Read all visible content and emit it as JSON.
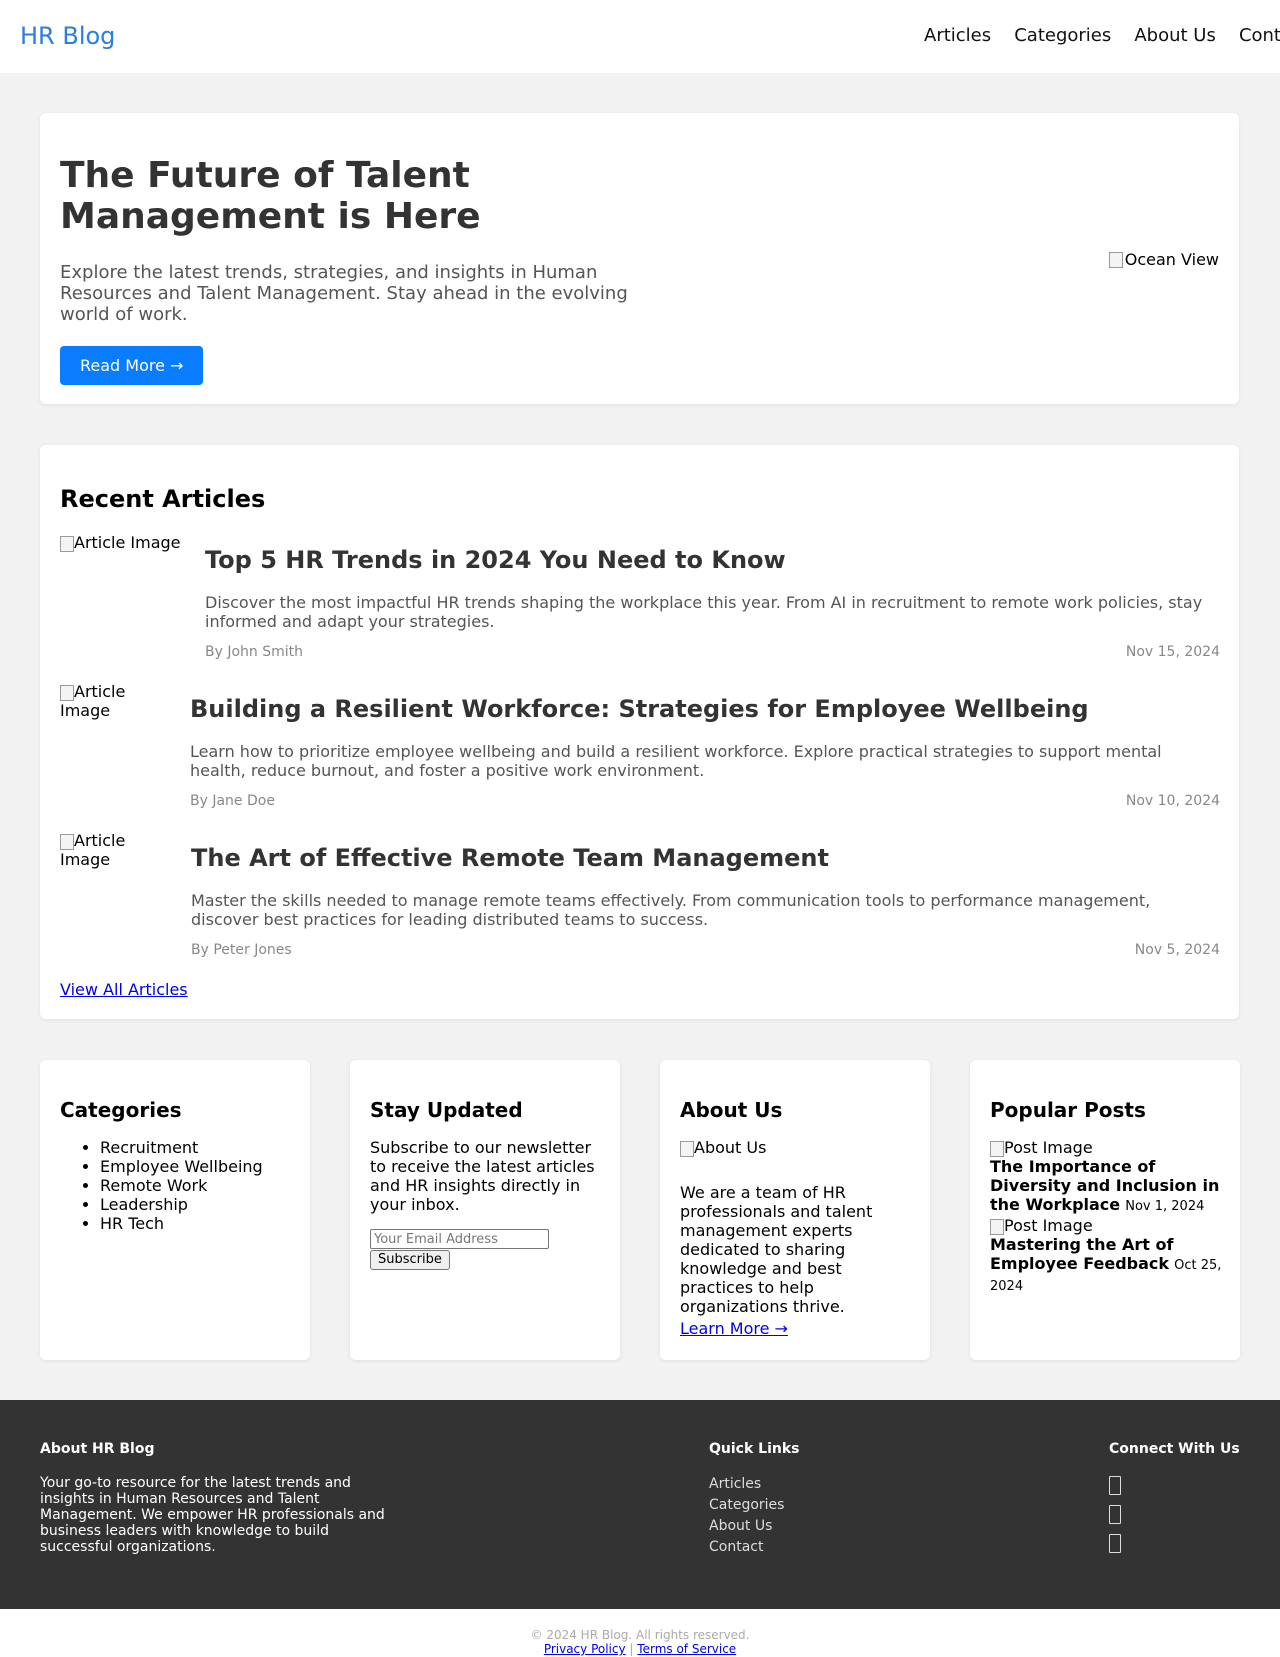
{
  "header": {
    "logo": "HR Blog",
    "nav": [
      "Articles",
      "Categories",
      "About Us",
      "Contact"
    ]
  },
  "hero": {
    "title": "The Future of Talent Management is Here",
    "description": "Explore the latest trends, strategies, and insights in Human Resources and Talent Management. Stay ahead in the evolving world of work.",
    "button": "Read More →",
    "image_alt": "Ocean View"
  },
  "recent": {
    "title": "Recent Articles",
    "articles": [
      {
        "image_alt": "Article Image",
        "title": "Top 5 HR Trends in 2024 You Need to Know",
        "excerpt": "Discover the most impactful HR trends shaping the workplace this year. From AI in recruitment to remote work policies, stay informed and adapt your strategies.",
        "author": "By John Smith",
        "date": "Nov 15, 2024"
      },
      {
        "image_alt": "Article Image",
        "title": "Building a Resilient Workforce: Strategies for Employee Wellbeing",
        "excerpt": "Learn how to prioritize employee wellbeing and build a resilient workforce. Explore practical strategies to support mental health, reduce burnout, and foster a positive work environment.",
        "author": "By Jane Doe",
        "date": "Nov 10, 2024"
      },
      {
        "image_alt": "Article Image",
        "title": "The Art of Effective Remote Team Management",
        "excerpt": "Master the skills needed to manage remote teams effectively. From communication tools to performance management, discover best practices for leading distributed teams to success.",
        "author": "By Peter Jones",
        "date": "Nov 5, 2024"
      }
    ],
    "view_all": "View All Articles"
  },
  "categories": {
    "title": "Categories",
    "items": [
      "Recruitment",
      "Employee Wellbeing",
      "Remote Work",
      "Leadership",
      "HR Tech"
    ]
  },
  "newsletter": {
    "title": "Stay Updated",
    "text": "Subscribe to our newsletter to receive the latest articles and HR insights directly in your inbox.",
    "placeholder": "Your Email Address",
    "button": "Subscribe"
  },
  "about": {
    "title": "About Us",
    "image_alt": "About Us",
    "text": "We are a team of HR professionals and talent management experts dedicated to sharing knowledge and best practices to help organizations thrive.",
    "link": "Learn More →"
  },
  "popular": {
    "title": "Popular Posts",
    "posts": [
      {
        "image_alt": "Post Image",
        "title": "The Importance of Diversity and Inclusion in the Workplace",
        "date": "Nov 1, 2024"
      },
      {
        "image_alt": "Post Image",
        "title": "Mastering the Art of Employee Feedback",
        "date": "Oct 25, 2024"
      }
    ]
  },
  "footer": {
    "about_heading": "About HR Blog",
    "about_text": "Your go-to resource for the latest trends and insights in Human Resources and Talent Management. We empower HR professionals and business leaders with knowledge to build successful organizations.",
    "links_heading": "Quick Links",
    "links": [
      "Articles",
      "Categories",
      "About Us",
      "Contact"
    ],
    "social_heading": "Connect With Us",
    "social_icons": [
      "social-icon",
      "social-icon",
      "social-icon"
    ]
  },
  "bottom": {
    "copyright": "© 2024 HR Blog. All rights reserved.",
    "privacy": "Privacy Policy",
    "separator": "|",
    "terms": "Terms of Service"
  },
  "colors": {
    "brand": "#2a7de1",
    "button": "#0a7cff",
    "footer_bg": "#333333",
    "page_bg": "#f2f2f2"
  }
}
